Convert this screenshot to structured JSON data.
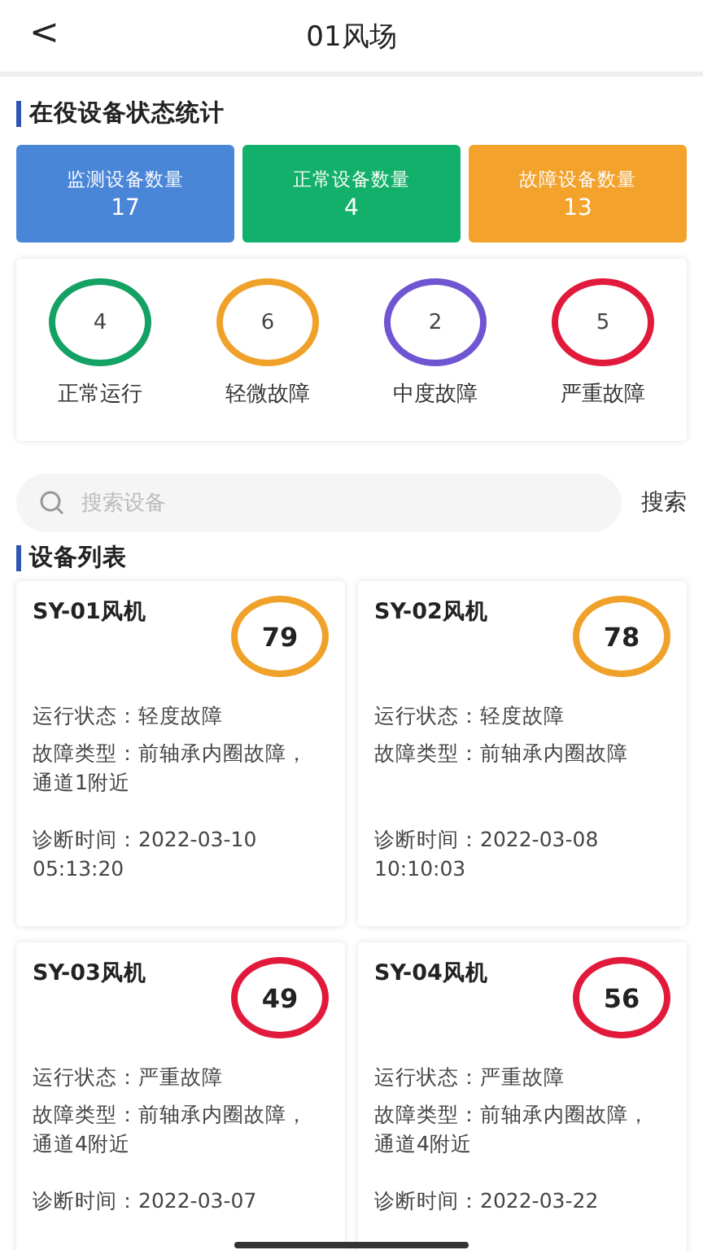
{
  "header": {
    "back": "<",
    "title": "01风场"
  },
  "stats_section": {
    "title": "在役设备状态统计"
  },
  "tiles": [
    {
      "label": "监测设备数量",
      "value": "17",
      "color": "#4a86d8"
    },
    {
      "label": "正常设备数量",
      "value": "4",
      "color": "#12b06a"
    },
    {
      "label": "故障设备数量",
      "value": "13",
      "color": "#f3a22c"
    }
  ],
  "status_counts": [
    {
      "count": "4",
      "label": "正常运行",
      "color": "#13a164"
    },
    {
      "count": "6",
      "label": "轻微故障",
      "color": "#f0a129"
    },
    {
      "count": "2",
      "label": "中度故障",
      "color": "#6f55d1"
    },
    {
      "count": "5",
      "label": "严重故障",
      "color": "#e11a3c"
    }
  ],
  "search": {
    "placeholder": "搜索设备",
    "button": "搜索"
  },
  "list_section": {
    "title": "设备列表"
  },
  "devices": [
    {
      "name": "SY-01风机",
      "score": "79",
      "color": "#f0a129",
      "status": "运行状态：轻度故障",
      "fault": "故障类型：前轴承内圈故障，通道1附近",
      "diagnosed": "诊断时间：2022-03-10 05:13:20"
    },
    {
      "name": "SY-02风机",
      "score": "78",
      "color": "#f0a129",
      "status": "运行状态：轻度故障",
      "fault": "故障类型：前轴承内圈故障",
      "diagnosed": "诊断时间：2022-03-08 10:10:03"
    },
    {
      "name": "SY-03风机",
      "score": "49",
      "color": "#e11a3c",
      "status": "运行状态：严重故障",
      "fault": "故障类型：前轴承内圈故障，通道4附近",
      "diagnosed": "诊断时间：2022-03-07"
    },
    {
      "name": "SY-04风机",
      "score": "56",
      "color": "#e11a3c",
      "status": "运行状态：严重故障",
      "fault": "故障类型：前轴承内圈故障，通道4附近",
      "diagnosed": "诊断时间：2022-03-22"
    }
  ]
}
